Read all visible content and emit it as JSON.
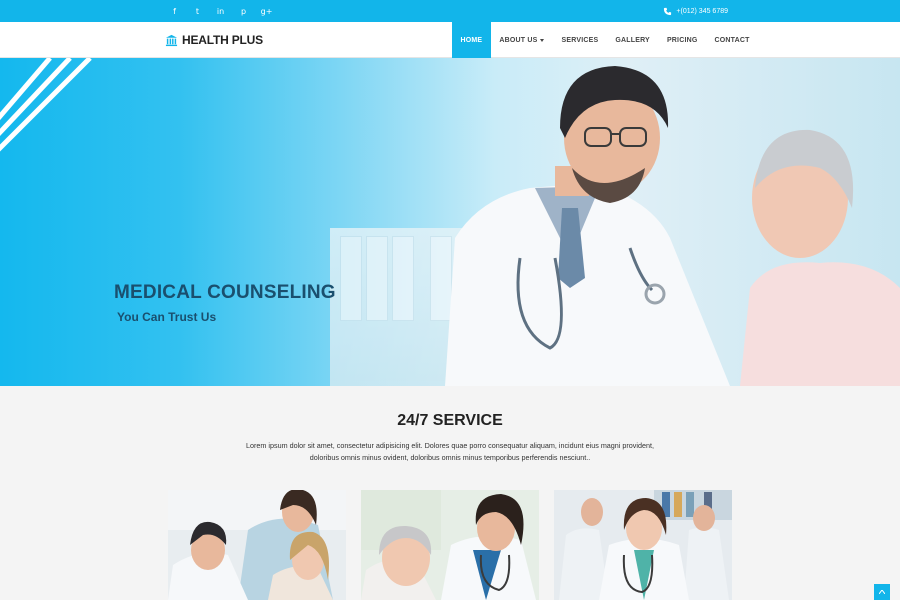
{
  "topbar": {
    "social": [
      {
        "icon": "facebook-icon",
        "glyph": "f"
      },
      {
        "icon": "twitter-icon",
        "glyph": "t"
      },
      {
        "icon": "linkedin-icon",
        "glyph": "in"
      },
      {
        "icon": "pinterest-icon",
        "glyph": "p"
      },
      {
        "icon": "google-plus-icon",
        "glyph": "g+"
      }
    ],
    "phone": "+(012) 345 6789"
  },
  "header": {
    "logo_text": "HEALTH PLUS",
    "nav": [
      {
        "label": "HOME",
        "active": true
      },
      {
        "label": "ABOUT US",
        "dropdown": true
      },
      {
        "label": "SERVICES"
      },
      {
        "label": "GALLERY"
      },
      {
        "label": "PRICING"
      },
      {
        "label": "CONTACT"
      }
    ]
  },
  "hero": {
    "title": "MEDICAL COUNSELING",
    "subtitle": "You Can Trust Us",
    "slides": 2,
    "active_slide": 1
  },
  "service": {
    "title": "24/7 SERVICE",
    "text": "Lorem ipsum dolor sit amet, consectetur adipisicing elit. Dolores quae porro consequatur aliquam, incidunt eius magni provident, doloribus omnis minus ovident, doloribus omnis minus temporibus perferendis nesciunt.."
  },
  "colors": {
    "accent": "#12b5ea",
    "heading": "#1a4f6e"
  }
}
